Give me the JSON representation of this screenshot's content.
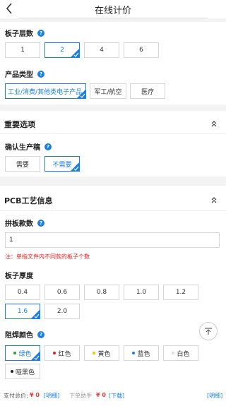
{
  "header": {
    "title": "在线计价"
  },
  "board_layers": {
    "label": "板子层数",
    "help": "?",
    "options": [
      "1",
      "2",
      "4",
      "6"
    ],
    "selected": "2"
  },
  "product_type": {
    "label": "产品类型",
    "help": "?",
    "options": [
      "工业/消费/其他类电子产品",
      "军工/航空",
      "医疗"
    ],
    "selected": "工业/消费/其他类电子产品"
  },
  "important_options": {
    "title": "重要选项",
    "confirm_draft": {
      "label": "确认生产稿",
      "help": "?",
      "options": [
        "需要",
        "不需要"
      ],
      "selected": "不需要"
    }
  },
  "pcb_info": {
    "title": "PCB工艺信息",
    "panel_count": {
      "label": "拼板款数",
      "help": "?",
      "value": "1",
      "note": "注：单指文件内不同款的板子个数"
    },
    "thickness": {
      "label": "板子厚度",
      "options": [
        "0.4",
        "0.6",
        "0.8",
        "1.0",
        "1.2",
        "1.6",
        "2.0"
      ],
      "selected": "1.6"
    },
    "solder_color": {
      "label": "阻焊颜色",
      "help": "?",
      "options": [
        {
          "label": "绿色",
          "color": "#2e9d3a"
        },
        {
          "label": "红色",
          "color": "#e02020"
        },
        {
          "label": "黄色",
          "color": "#f2c200"
        },
        {
          "label": "蓝色",
          "color": "#1a7fe0"
        },
        {
          "label": "白色",
          "color": "#dddddd"
        },
        {
          "label": "哑黑色",
          "color": "#222222"
        }
      ],
      "selected": "绿色"
    }
  },
  "footer": {
    "total_label": "支付总价:",
    "total_value": "¥ 0",
    "total_link": "[明细]",
    "helper_label": "下单助手",
    "helper_value": "¥ 0",
    "helper_link": "[下载]",
    "right_link": "[明细]"
  },
  "colors": {
    "accent": "#1a7fe0",
    "price": "#e53935"
  },
  "icons": [
    "back-icon",
    "help-icon",
    "check-corner-icon",
    "collapse-up-icon",
    "scroll-top-icon"
  ]
}
